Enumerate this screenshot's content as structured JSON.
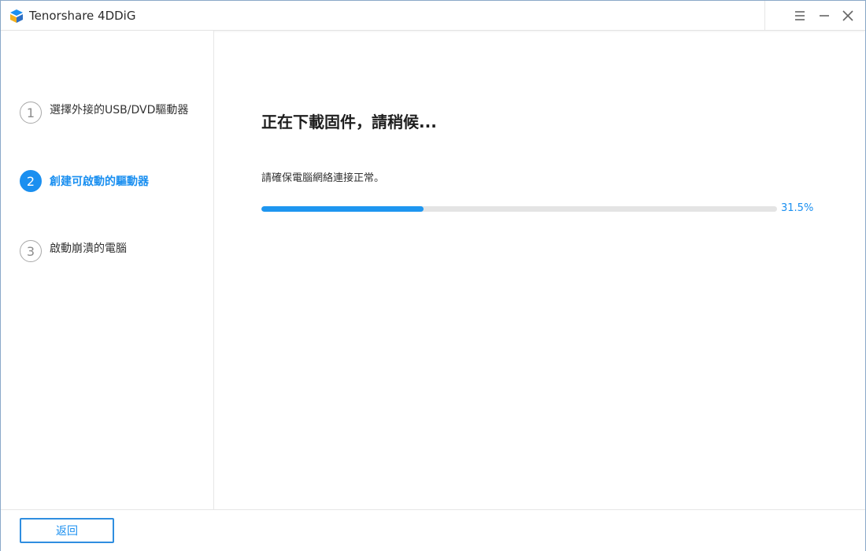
{
  "titlebar": {
    "app_title": "Tenorshare 4DDiG",
    "icons": [
      "logo-icon",
      "menu-icon",
      "minimize-icon",
      "close-icon"
    ]
  },
  "sidebar": {
    "steps": [
      {
        "number": "1",
        "label": "選擇外接的USB/DVD驅動器",
        "active": false
      },
      {
        "number": "2",
        "label": "創建可啟動的驅動器",
        "active": true
      },
      {
        "number": "3",
        "label": "啟動崩潰的電腦",
        "active": false
      }
    ]
  },
  "main": {
    "title": "正在下載固件，請稍候...",
    "subtitle": "請確保電腦網絡連接正常。",
    "progress": {
      "value": 0.315,
      "label": "31.5%"
    }
  },
  "footer": {
    "back_label": "返回"
  },
  "colors": {
    "accent": "#1a8ff0",
    "track": "#e4e4e4",
    "border": "#8aa9c9"
  }
}
